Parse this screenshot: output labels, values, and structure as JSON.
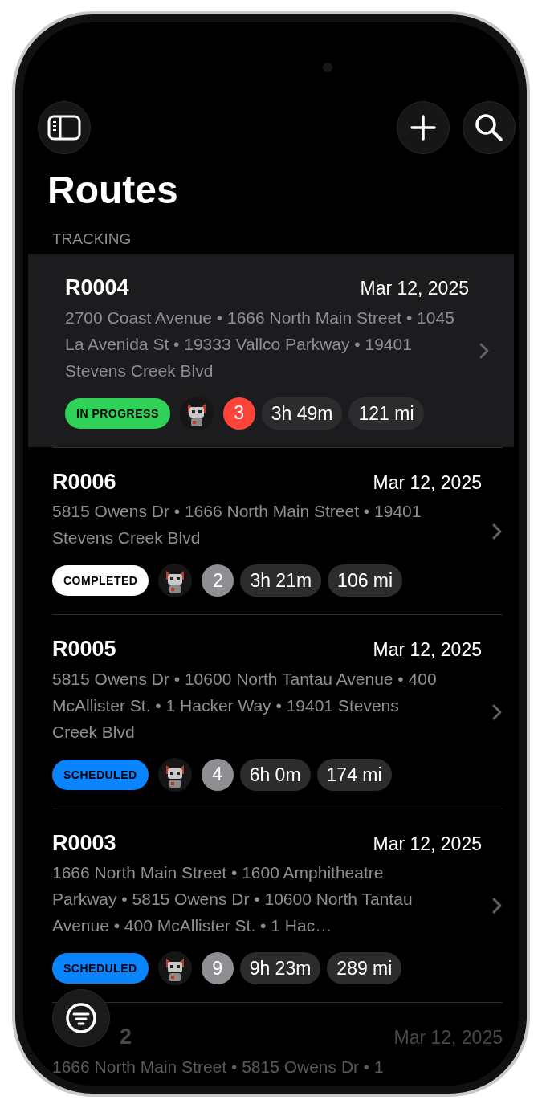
{
  "title": "Routes",
  "section_header": "TRACKING",
  "routes": [
    {
      "id": "R0004",
      "date": "Mar 12, 2025",
      "stops": "2700 Coast Avenue • 1666 North Main Street • 1045 La Avenida St • 19333 Vallco Parkway  • 19401 Stevens Creek Blvd",
      "selected": true,
      "dimmed": false,
      "status": {
        "label": "IN PROGRESS",
        "kind": "in_progress"
      },
      "stop_count": {
        "label": "3",
        "color": "#ff453a"
      },
      "duration": "3h 49m",
      "distance": "121 mi"
    },
    {
      "id": "R0006",
      "date": "Mar 12, 2025",
      "stops": "5815 Owens Dr • 1666 North Main Street • 19401 Stevens Creek Blvd",
      "selected": false,
      "dimmed": false,
      "status": {
        "label": "COMPLETED",
        "kind": "completed"
      },
      "stop_count": {
        "label": "2",
        "color": "#8e8e93"
      },
      "duration": "3h 21m",
      "distance": "106 mi"
    },
    {
      "id": "R0005",
      "date": "Mar 12, 2025",
      "stops": "5815 Owens Dr • 10600 North Tantau Avenue • 400 McAllister St.  • 1 Hacker Way • 19401 Stevens Creek Blvd",
      "selected": false,
      "dimmed": false,
      "status": {
        "label": "SCHEDULED",
        "kind": "scheduled"
      },
      "stop_count": {
        "label": "4",
        "color": "#8e8e93"
      },
      "duration": "6h 0m",
      "distance": "174 mi"
    },
    {
      "id": "R0003",
      "date": "Mar 12, 2025",
      "stops": "1666 North Main Street • 1600 Amphitheatre Parkway • 5815 Owens Dr • 10600 North Tantau Avenue • 400 McAllister St.  • 1 Hac…",
      "selected": false,
      "dimmed": false,
      "status": {
        "label": "SCHEDULED",
        "kind": "scheduled"
      },
      "stop_count": {
        "label": "9",
        "color": "#8e8e93"
      },
      "duration": "9h 23m",
      "distance": "289 mi"
    },
    {
      "id_tail": "2",
      "date": "Mar 12, 2025",
      "stops": "1666 North Main Street • 5815 Owens Dr • 1",
      "selected": false,
      "dimmed": true
    }
  ]
}
